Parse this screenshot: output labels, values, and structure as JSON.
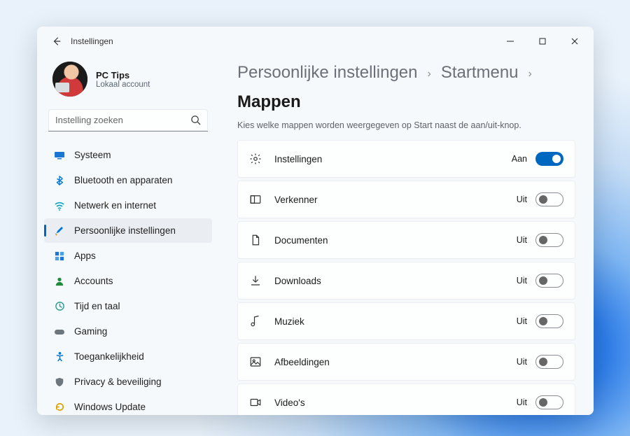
{
  "window": {
    "title": "Instellingen"
  },
  "profile": {
    "name": "PC Tips",
    "subtitle": "Lokaal account"
  },
  "search": {
    "placeholder": "Instelling zoeken"
  },
  "sidebar": {
    "items": [
      {
        "label": "Systeem"
      },
      {
        "label": "Bluetooth en apparaten"
      },
      {
        "label": "Netwerk en internet"
      },
      {
        "label": "Persoonlijke instellingen"
      },
      {
        "label": "Apps"
      },
      {
        "label": "Accounts"
      },
      {
        "label": "Tijd en taal"
      },
      {
        "label": "Gaming"
      },
      {
        "label": "Toegankelijkheid"
      },
      {
        "label": "Privacy & beveiliging"
      },
      {
        "label": "Windows Update"
      }
    ]
  },
  "breadcrumb": {
    "a": "Persoonlijke instellingen",
    "b": "Startmenu",
    "c": "Mappen"
  },
  "subtitle": "Kies welke mappen worden weergegeven op Start naast de aan/uit-knop.",
  "toggle_labels": {
    "on": "Aan",
    "off": "Uit"
  },
  "folders": [
    {
      "label": "Instellingen",
      "state": "on"
    },
    {
      "label": "Verkenner",
      "state": "off"
    },
    {
      "label": "Documenten",
      "state": "off"
    },
    {
      "label": "Downloads",
      "state": "off"
    },
    {
      "label": "Muziek",
      "state": "off"
    },
    {
      "label": "Afbeeldingen",
      "state": "off"
    },
    {
      "label": "Video's",
      "state": "off"
    }
  ]
}
